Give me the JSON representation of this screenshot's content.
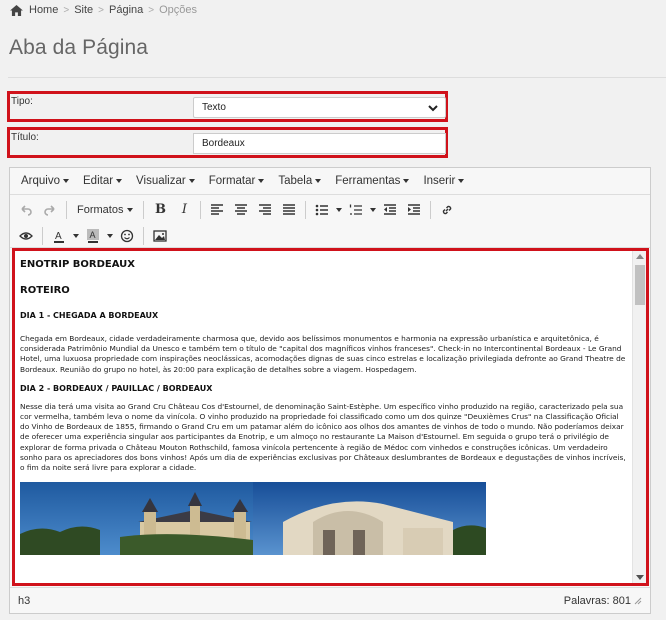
{
  "breadcrumb": {
    "items": [
      "Home",
      "Site",
      "Página",
      "Opções"
    ]
  },
  "page": {
    "title": "Aba da Página"
  },
  "form": {
    "tipo_label": "Tipo:",
    "tipo_value": "Texto",
    "titulo_label": "Título:",
    "titulo_value": "Bordeaux"
  },
  "editor": {
    "menus": [
      "Arquivo",
      "Editar",
      "Visualizar",
      "Formatar",
      "Tabela",
      "Ferramentas",
      "Inserir"
    ],
    "formats_label": "Formatos",
    "status_path": "h3",
    "word_count": "Palavras: 801",
    "content": {
      "heading1": "ENOTRIP BORDEAUX",
      "heading2": "ROTEIRO",
      "day1_title": "DIA 1 - CHEGADA A BORDEAUX",
      "day1_text": "Chegada em Bordeaux, cidade verdadeiramente charmosa que, devido aos belíssimos monumentos e harmonia na expressão urbanística e arquitetônica, é considerada Patrimônio Mundial da Unesco e também tem o título de \"capital dos magníficos vinhos franceses\". Check-in no Intercontinental Bordeaux - Le Grand Hotel, uma luxuosa propriedade com inspirações neoclássicas, acomodações dignas de suas cinco estrelas e localização privilegiada defronte ao Grand Theatre de Bordeaux. Reunião do grupo no hotel, às 20:00 para explicação de detalhes sobre a viagem. Hospedagem.",
      "day2_title": "DIA 2 - BORDEAUX / PAUILLAC / BORDEAUX",
      "day2_text": "Nesse dia terá uma visita ao Grand Cru Château Cos d'Estournel, de denominação Saint-Estèphe. Um específico vinho produzido na região, caracterizado pela sua cor vermelha, também leva o nome da vinícola. O vinho produzido na propriedade foi classificado como um dos quinze \"Deuxièmes Crus\" na Classificação Oficial do Vinho de Bordeaux de 1855, firmando o Grand Cru em um patamar além do icônico aos olhos dos amantes de vinhos de todo o mundo. Não poderíamos deixar de oferecer uma experiência singular aos participantes da Enotrip, e um almoço no restaurante La Maison d'Estournel. Em seguida o grupo terá o privilégio de explorar de forma privada o Château Mouton Rothschild, famosa vinícola pertencente à região de Médoc com vinhedos e construções icônicas. Um verdadeiro sonho para os apreciadores dos bons vinhos! Após um dia de experiências exclusivas por Châteaux deslumbrantes de Bordeaux e degustações de vinhos incríveis, o fim da noite será livre para explorar a cidade."
    }
  },
  "colors": {
    "highlight": "#d0121b",
    "background": "#f1f1f1"
  }
}
